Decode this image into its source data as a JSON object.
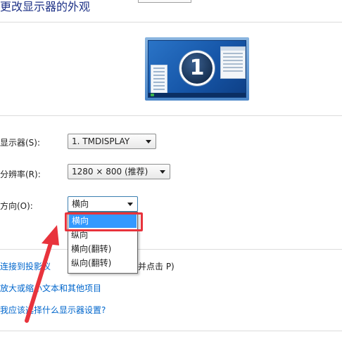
{
  "page": {
    "heading": "更改显示器的外观"
  },
  "preview": {
    "monitor_number": "1"
  },
  "display_setting": {
    "label": "显示器(S):",
    "value": "1. TMDISPLAY"
  },
  "resolution_setting": {
    "label": "分辨率(R):",
    "value": "1280 × 800 (推荐)"
  },
  "orientation_setting": {
    "label": "方向(O):",
    "value": "横向",
    "options": [
      "横向",
      "纵向",
      "横向(翻转)",
      "纵向(翻转)"
    ],
    "highlighted_index": 0
  },
  "links": {
    "projector": "连接到投影仪",
    "projector_hint": "并点击 P)",
    "enlarge_text": "放大或缩小文本和其他项目",
    "which_settings": "我应该选择什么显示器设置?"
  },
  "colors": {
    "heading": "#1e3287",
    "link": "#0066cc",
    "selection": "#3399ff",
    "annotation_red": "#e8333c"
  },
  "icons": {
    "dropdown_caret": "chevron-down-icon",
    "monitor_preview": "monitor-icon",
    "annotation": "red-arrow-icon"
  }
}
